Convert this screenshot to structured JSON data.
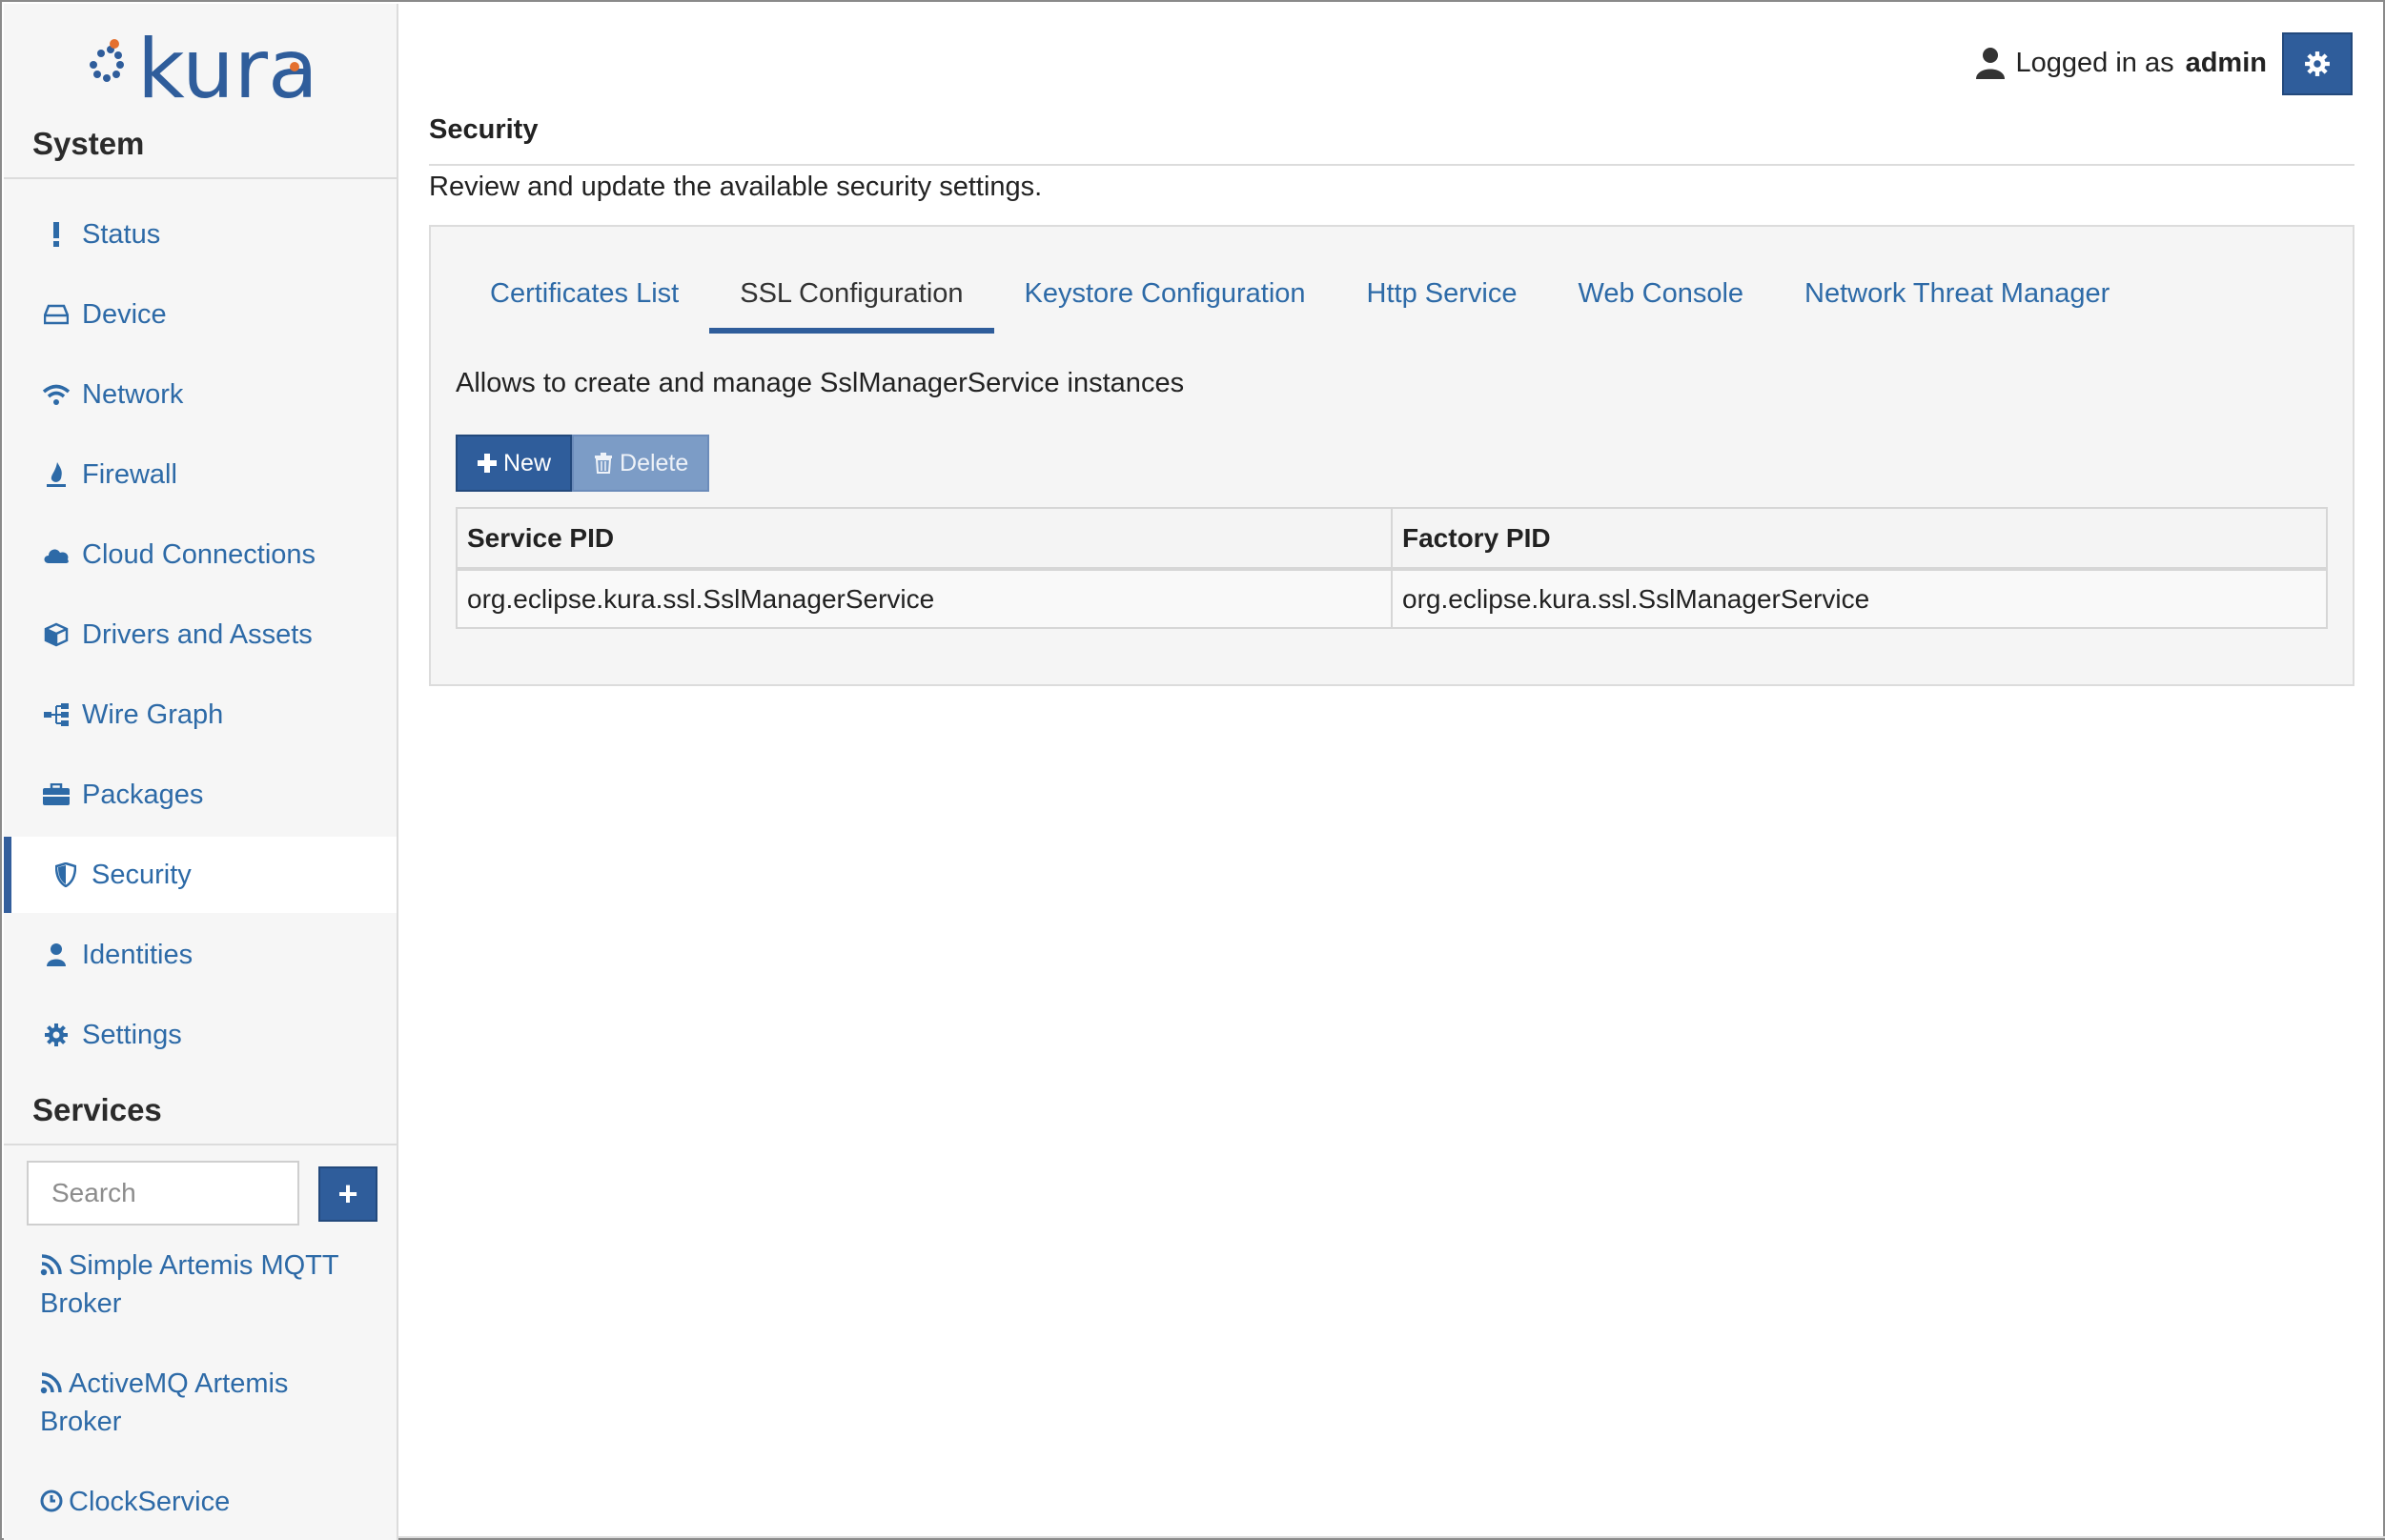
{
  "brand": {
    "name": "kura"
  },
  "sidebar": {
    "system_title": "System",
    "items": [
      {
        "label": "Status",
        "icon": "exclamation-icon"
      },
      {
        "label": "Device",
        "icon": "hdd-icon"
      },
      {
        "label": "Network",
        "icon": "wifi-icon"
      },
      {
        "label": "Firewall",
        "icon": "fire-icon"
      },
      {
        "label": "Cloud Connections",
        "icon": "cloud-icon"
      },
      {
        "label": "Drivers and Assets",
        "icon": "cube-icon"
      },
      {
        "label": "Wire Graph",
        "icon": "sitemap-icon"
      },
      {
        "label": "Packages",
        "icon": "briefcase-icon"
      },
      {
        "label": "Security",
        "icon": "shield-icon",
        "active": true
      },
      {
        "label": "Identities",
        "icon": "user-icon"
      },
      {
        "label": "Settings",
        "icon": "gear-icon"
      }
    ],
    "services_title": "Services",
    "search": {
      "placeholder": "Search",
      "value": ""
    },
    "add_button": "+",
    "services": [
      {
        "label": "Simple Artemis MQTT Broker",
        "icon": "rss-icon"
      },
      {
        "label": "ActiveMQ Artemis Broker",
        "icon": "rss-icon"
      },
      {
        "label": "ClockService",
        "icon": "clock-icon"
      }
    ]
  },
  "header": {
    "logged_in_text": "Logged in as",
    "username": "admin"
  },
  "main": {
    "title": "Security",
    "description": "Review and update the available security settings.",
    "tabs": [
      {
        "label": "Certificates List"
      },
      {
        "label": "SSL Configuration",
        "active": true
      },
      {
        "label": "Keystore Configuration"
      },
      {
        "label": "Http Service"
      },
      {
        "label": "Web Console"
      },
      {
        "label": "Network Threat Manager"
      }
    ],
    "panel_description": "Allows to create and manage SslManagerService instances",
    "buttons": {
      "new": "New",
      "delete": "Delete"
    },
    "table": {
      "columns": [
        "Service PID",
        "Factory PID"
      ],
      "rows": [
        [
          "org.eclipse.kura.ssl.SslManagerService",
          "org.eclipse.kura.ssl.SslManagerService"
        ]
      ]
    }
  },
  "colors": {
    "accent": "#2f5d9b",
    "link": "#2d6aa7",
    "sidebar_bg": "#f6f6f6",
    "panel_bg": "#f5f5f5"
  }
}
